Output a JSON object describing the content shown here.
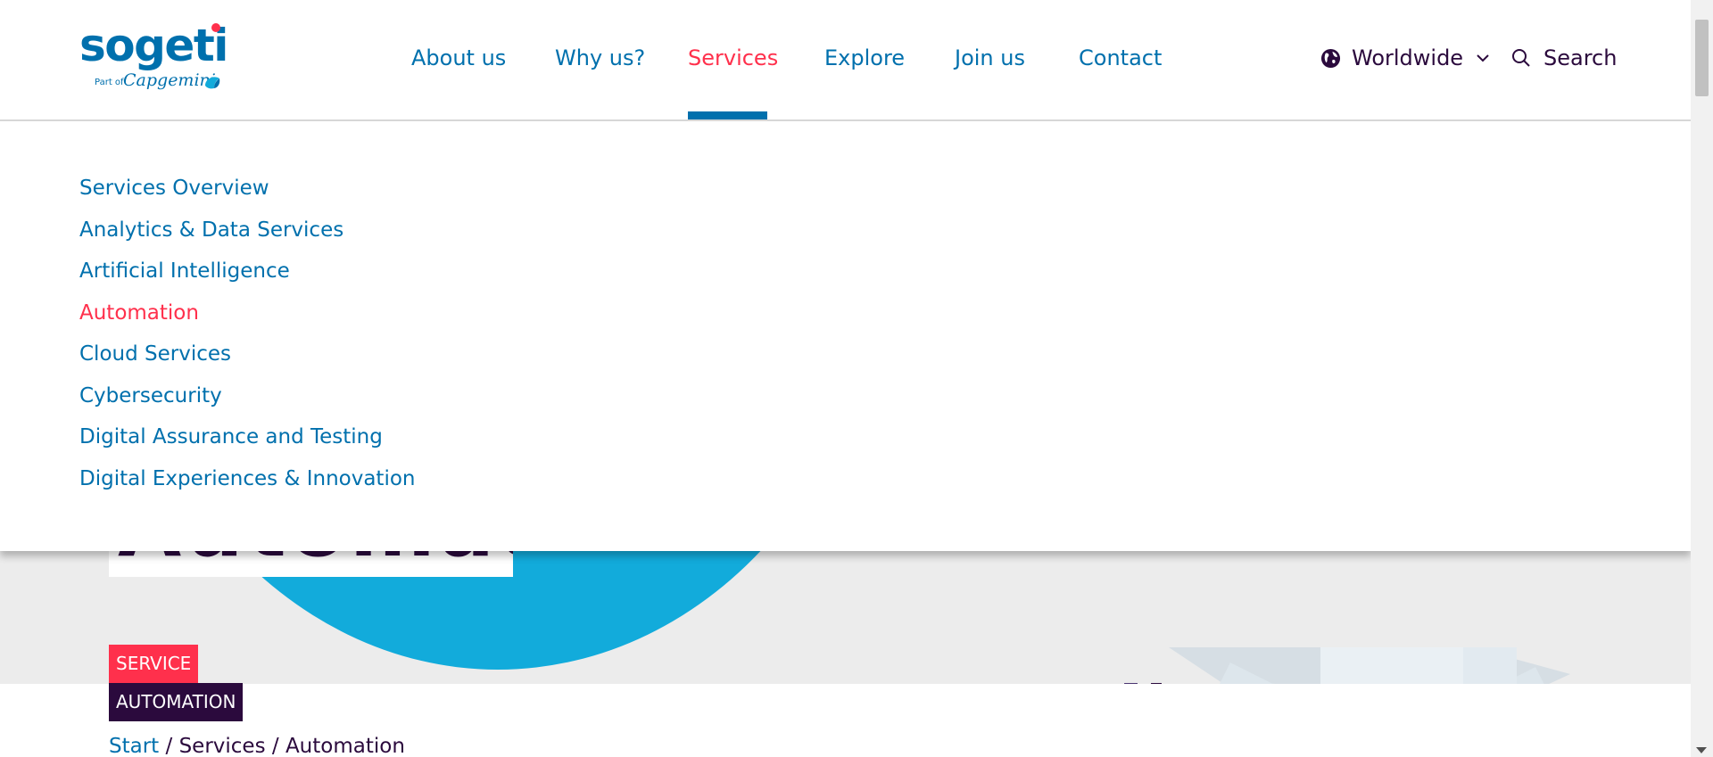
{
  "header": {
    "logo": {
      "word": "sogeti",
      "part_of": "Part of",
      "parent": "Capgemini"
    },
    "nav": [
      {
        "label": "About us",
        "active": false
      },
      {
        "label": "Why us?",
        "active": false
      },
      {
        "label": "Services",
        "active": true
      },
      {
        "label": "Explore",
        "active": false
      },
      {
        "label": "Join us",
        "active": false
      },
      {
        "label": "Contact",
        "active": false
      }
    ],
    "region_label": "Worldwide",
    "search_label": "Search"
  },
  "dropdown": {
    "items": [
      {
        "label": "Services Overview",
        "active": false
      },
      {
        "label": "Analytics & Data Services",
        "active": false
      },
      {
        "label": "Artificial Intelligence",
        "active": false
      },
      {
        "label": "Automation",
        "active": true
      },
      {
        "label": "Cloud Services",
        "active": false
      },
      {
        "label": "Cybersecurity",
        "active": false
      },
      {
        "label": "Digital Assurance and Testing",
        "active": false
      },
      {
        "label": "Digital Experiences & Innovation",
        "active": false
      }
    ]
  },
  "hero": {
    "title": "Automation"
  },
  "tags": {
    "service": "SERVICE",
    "topic": "AUTOMATION"
  },
  "breadcrumb": {
    "start": "Start",
    "sep": " / ",
    "services": "Services",
    "current": "Automation"
  },
  "colors": {
    "brand_blue": "#0070ad",
    "accent_red": "#ff304c",
    "dark_purple": "#2b0a3d",
    "hero_cyan": "#12abdb"
  },
  "icons": {
    "region": "globe-icon",
    "region_toggle": "chevron-down-icon",
    "search": "search-icon"
  }
}
